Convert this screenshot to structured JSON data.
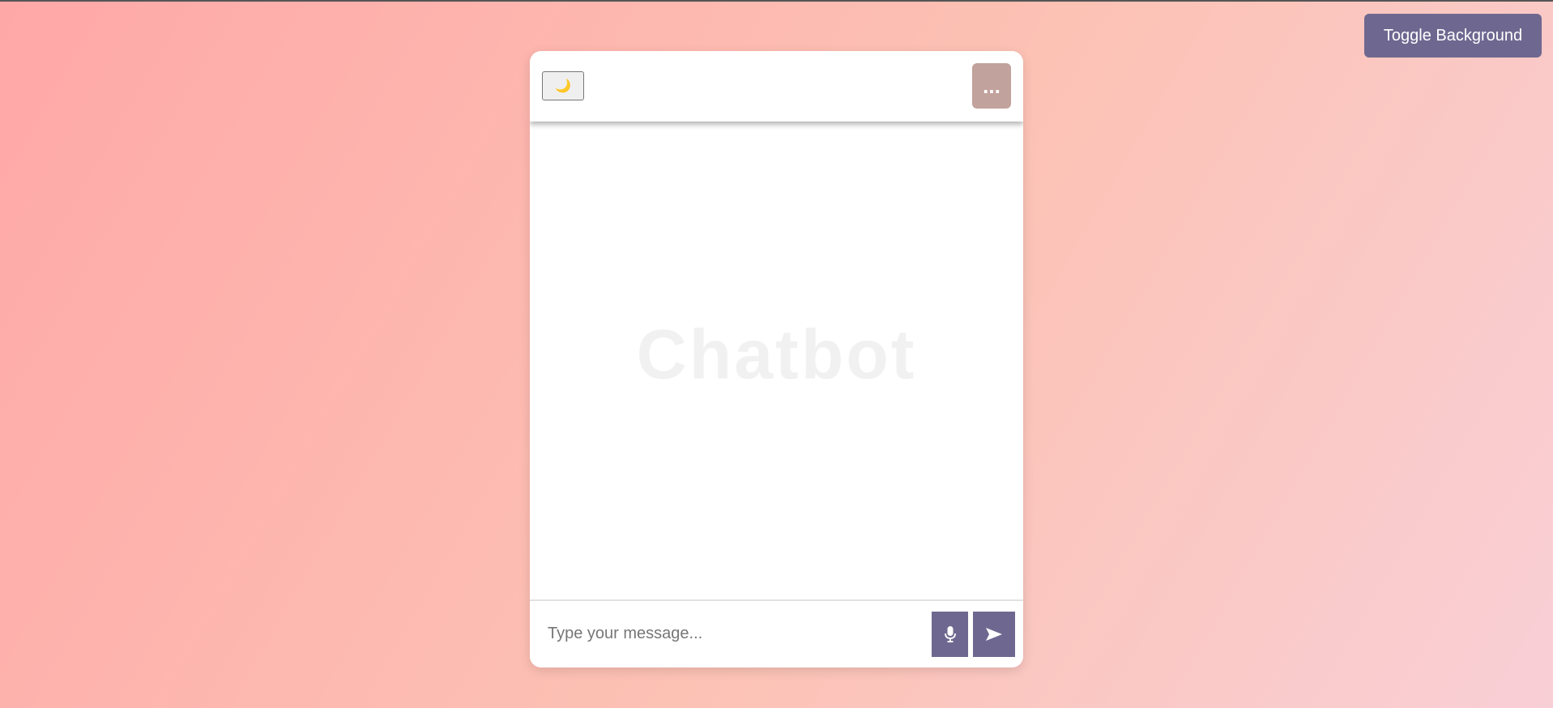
{
  "page": {
    "toggle_background_label": "Toggle Background"
  },
  "header": {
    "theme_toggle_icon": "moon-icon",
    "theme_toggle_glyph": "🌙",
    "menu_icon": "ellipsis-icon",
    "menu_glyph": "..."
  },
  "body": {
    "watermark": "Chatbot"
  },
  "footer": {
    "input_placeholder": "Type your message...",
    "input_value": "",
    "mic_icon": "microphone-icon",
    "send_icon": "send-arrow-icon"
  },
  "colors": {
    "accent": "#6e6890",
    "menu_button": "#c2a29c",
    "background_start": "#ffa8a8",
    "background_end": "#f9cfd6"
  }
}
